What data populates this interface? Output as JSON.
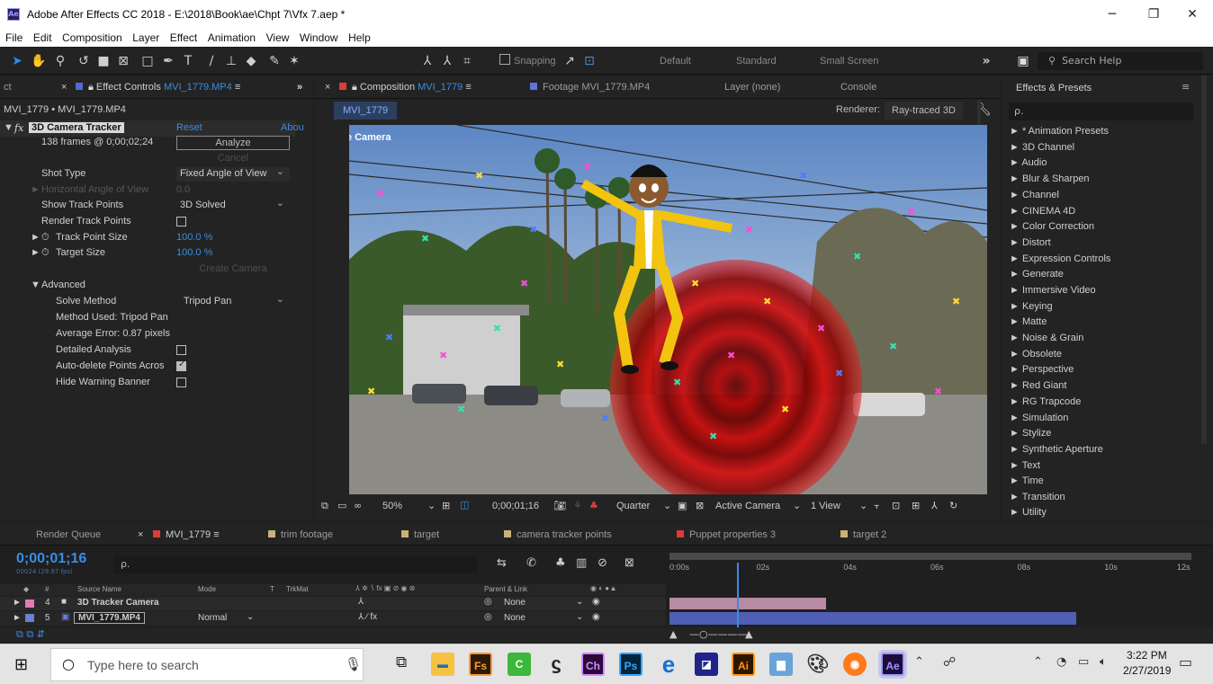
{
  "window": {
    "title": "Adobe After Effects CC 2018 - E:\\2018\\Book\\ae\\Chpt 7\\Vfx 7.aep *",
    "icon_label": "Ae"
  },
  "menu": [
    "File",
    "Edit",
    "Composition",
    "Layer",
    "Effect",
    "Animation",
    "View",
    "Window",
    "Help"
  ],
  "toolbar": {
    "snapping_label": "Snapping",
    "workspaces": [
      "Default",
      "Standard",
      "Small Screen"
    ],
    "search_placeholder": "Search Help"
  },
  "effect_controls": {
    "tab_prefix": "ct",
    "tab_label": "Effect Controls",
    "tab_file": "MVI_1779.MP4",
    "breadcrumb": "MVI_1779 • MVI_1779.MP4",
    "effect_name": "3D Camera Tracker",
    "fx_glyph": "fx",
    "reset": "Reset",
    "about": "Abou",
    "frames_info": "138 frames @ 0;00;02;24",
    "analyze": "Analyze",
    "cancel": "Cancel",
    "shot_type_label": "Shot Type",
    "shot_type_value": "Fixed Angle of View",
    "hfov_label": "Horizontal Angle of View",
    "hfov_value": "0.0",
    "show_track_points_label": "Show Track Points",
    "show_track_points_value": "3D Solved",
    "render_track_points_label": "Render Track Points",
    "track_point_size_label": "Track Point Size",
    "track_point_size_value": "100.0 %",
    "target_size_label": "Target Size",
    "target_size_value": "100.0 %",
    "create_camera": "Create Camera",
    "advanced_label": "Advanced",
    "solve_method_label": "Solve Method",
    "solve_method_value": "Tripod Pan",
    "method_used": "Method Used: Tripod Pan",
    "average_error": "Average Error: 0.87 pixels",
    "detailed_analysis_label": "Detailed Analysis",
    "auto_delete_label": "Auto-delete Points Acros",
    "hide_warning_label": "Hide Warning Banner"
  },
  "composition": {
    "tab_label": "Composition",
    "tab_comp": "MVI_1779",
    "footage_tab": "Footage MVI_1779.MP4",
    "layer_tab": "Layer (none)",
    "console_tab": "Console",
    "comp_chip": "MVI_1779",
    "renderer_label": "Renderer:",
    "renderer_value": "Ray-traced 3D",
    "active_camera_overlay": "Active Camera",
    "zoom": "50%",
    "timecode": "0;00;01;16",
    "resolution": "Quarter",
    "camera_menu": "Active Camera",
    "views_menu": "1 View"
  },
  "effects_presets": {
    "title": "Effects & Presets",
    "search_placeholder": "ρ.",
    "items": [
      "* Animation Presets",
      "3D Channel",
      "Audio",
      "Blur & Sharpen",
      "Channel",
      "CINEMA 4D",
      "Color Correction",
      "Distort",
      "Expression Controls",
      "Generate",
      "Immersive Video",
      "Keying",
      "Matte",
      "Noise & Grain",
      "Obsolete",
      "Perspective",
      "Red Giant",
      "RG Trapcode",
      "Simulation",
      "Stylize",
      "Synthetic Aperture",
      "Text",
      "Time",
      "Transition",
      "Utility"
    ]
  },
  "timeline": {
    "tabs": [
      {
        "label": "Render Queue",
        "color": ""
      },
      {
        "label": "MVI_1779",
        "color": "#e03a3a"
      },
      {
        "label": "trim footage",
        "color": "#c8b27a"
      },
      {
        "label": "target",
        "color": "#c8b27a"
      },
      {
        "label": "camera tracker points",
        "color": "#c8b27a"
      },
      {
        "label": "Puppet properties 3",
        "color": "#e03a3a"
      },
      {
        "label": "target 2",
        "color": "#c8b27a"
      }
    ],
    "current_time": "0;00;01;16",
    "frame_info": "00024 (29.97 fps)",
    "search_placeholder": "ρ.",
    "ruler": [
      "0:00s",
      "02s",
      "04s",
      "06s",
      "08s",
      "10s",
      "12s"
    ],
    "columns": {
      "num": "#",
      "source_name": "Source Name",
      "mode": "Mode",
      "t": "T",
      "trkmat": "TrkMat",
      "parent": "Parent & Link"
    },
    "layers": [
      {
        "num": "4",
        "name": "3D Tracker Camera",
        "mode": "",
        "parent": "None",
        "color": "#e37ab8",
        "bar_color": "#b78aa5",
        "bar_end": 0.3
      },
      {
        "num": "5",
        "name": "MVI_1779.MP4",
        "mode": "Normal",
        "parent": "None",
        "color": "#6d7fd6",
        "bar_color": "#4f5fb5",
        "bar_end": 0.78
      }
    ],
    "playhead_fraction": 0.13
  },
  "taskbar": {
    "search_placeholder": "Type here to search",
    "apps": [
      "Fs",
      "Ch",
      "Ps",
      "Ai",
      "Ae"
    ],
    "time": "3:22 PM",
    "date": "2/27/2019"
  }
}
